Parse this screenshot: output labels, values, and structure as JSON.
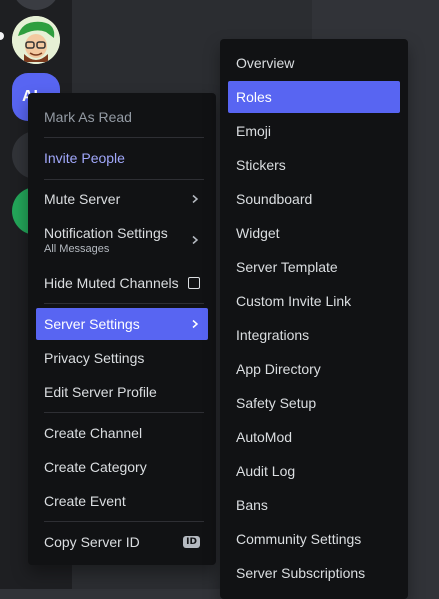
{
  "server_rail": {
    "partial_server_initials": "AI"
  },
  "context_menu": {
    "items": [
      {
        "label": "Mark As Read"
      },
      {
        "label": "Invite People"
      },
      {
        "label": "Mute Server"
      },
      {
        "label": "Notification Settings",
        "sublabel": "All Messages"
      },
      {
        "label": "Hide Muted Channels"
      },
      {
        "label": "Server Settings"
      },
      {
        "label": "Privacy Settings"
      },
      {
        "label": "Edit Server Profile"
      },
      {
        "label": "Create Channel"
      },
      {
        "label": "Create Category"
      },
      {
        "label": "Create Event"
      },
      {
        "label": "Copy Server ID",
        "badge": "ID"
      }
    ]
  },
  "submenu": {
    "items": [
      {
        "label": "Overview"
      },
      {
        "label": "Roles"
      },
      {
        "label": "Emoji"
      },
      {
        "label": "Stickers"
      },
      {
        "label": "Soundboard"
      },
      {
        "label": "Widget"
      },
      {
        "label": "Server Template"
      },
      {
        "label": "Custom Invite Link"
      },
      {
        "label": "Integrations"
      },
      {
        "label": "App Directory"
      },
      {
        "label": "Safety Setup"
      },
      {
        "label": "AutoMod"
      },
      {
        "label": "Audit Log"
      },
      {
        "label": "Bans"
      },
      {
        "label": "Community Settings"
      },
      {
        "label": "Server Subscriptions"
      }
    ]
  },
  "colors": {
    "accent": "#5865f2",
    "invite_text": "#a1a8fb",
    "menu_bg": "#111214",
    "rail_bg": "#1e1f22"
  }
}
